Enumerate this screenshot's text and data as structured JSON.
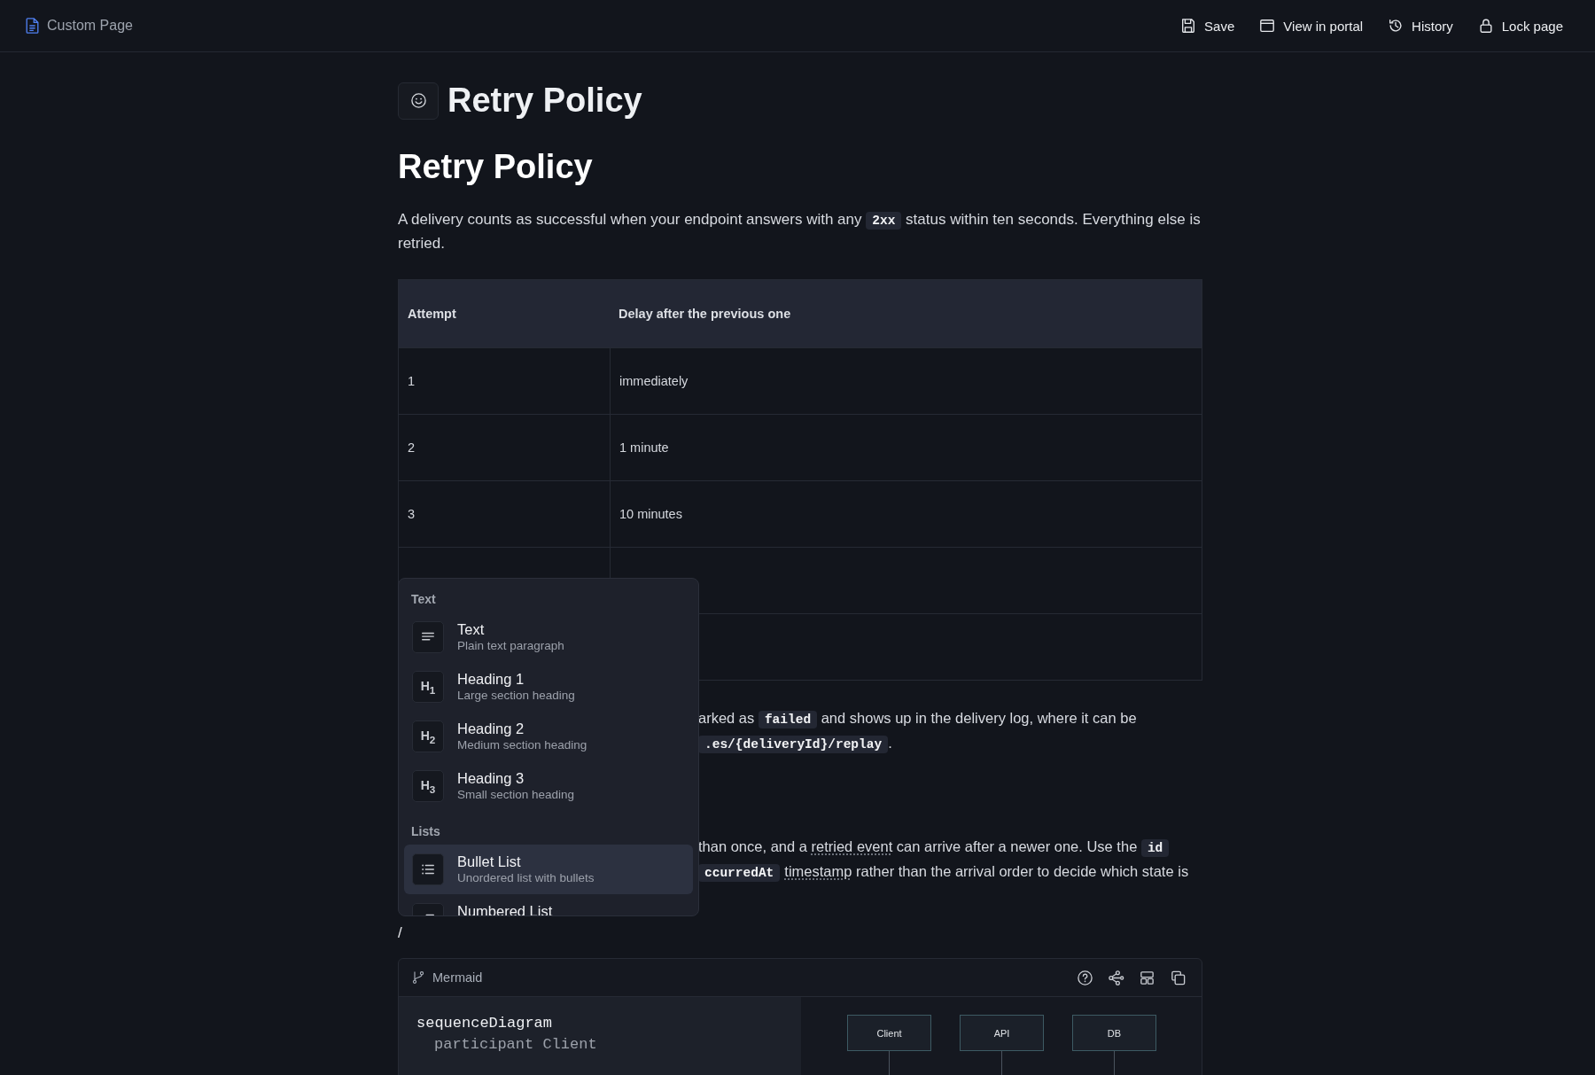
{
  "topbar": {
    "page_name": "Custom Page",
    "actions": [
      {
        "kind": "save",
        "label": "Save"
      },
      {
        "kind": "portal",
        "label": "View in portal"
      },
      {
        "kind": "history",
        "label": "History"
      },
      {
        "kind": "lock",
        "label": "Lock page"
      }
    ]
  },
  "page_title": "Retry Policy",
  "heading": "Retry Policy",
  "intro": [
    {
      "kind": "text",
      "text": "A delivery counts as successful when your endpoint answers with any "
    },
    {
      "kind": "code",
      "text": "2xx"
    },
    {
      "kind": "text",
      "text": " status within ten seconds. Everything else is retried."
    }
  ],
  "table": {
    "columns": [
      "Attempt",
      "Delay after the previous one"
    ],
    "rows": [
      {
        "kind": "row",
        "cells": [
          "1",
          "immediately"
        ]
      },
      {
        "kind": "row",
        "cells": [
          "2",
          "1 minute"
        ]
      },
      {
        "kind": "row",
        "cells": [
          "3",
          "10 minutes"
        ]
      },
      {
        "kind": "covered"
      },
      {
        "kind": "covered"
      }
    ]
  },
  "paragraph_fragments": [
    {
      "lines": [
        [
          {
            "kind": "text",
            "text": "arked as "
          },
          {
            "kind": "code",
            "text": "failed"
          },
          {
            "kind": "text",
            "text": " and shows up in the delivery log, where it can be"
          }
        ],
        [
          {
            "kind": "code",
            "text": ".es/{deliveryId}/replay"
          },
          {
            "kind": "text",
            "text": "."
          }
        ]
      ]
    },
    {
      "lines": [
        [
          {
            "kind": "text",
            "text": "than once, and a "
          },
          {
            "kind": "term",
            "text": "retried event"
          },
          {
            "kind": "text",
            "text": " can arrive after a newer one. Use the "
          },
          {
            "kind": "code",
            "text": "id"
          }
        ],
        [
          {
            "kind": "code",
            "text": "ccurredAt"
          },
          {
            "kind": "term",
            "text": "timestamp"
          },
          {
            "kind": "text",
            "text": " rather than the arrival order to decide which state is"
          }
        ]
      ]
    }
  ],
  "slash_text": "/",
  "mermaid": {
    "label": "Mermaid",
    "code_lines": [
      {
        "kind": "keyword",
        "text": "sequenceDiagram"
      },
      {
        "kind": "statement",
        "text": "participant Client"
      }
    ],
    "participants": [
      "Client",
      "API",
      "DB"
    ]
  },
  "slash_menu": {
    "sections": [
      {
        "label": "Text",
        "items": [
          {
            "kind": "text",
            "title": "Text",
            "subtitle": "Plain text paragraph",
            "selected": false
          },
          {
            "kind": "heading",
            "badge": "H$_{1}$",
            "title": "Heading 1",
            "subtitle": "Large section heading",
            "selected": false
          },
          {
            "kind": "heading",
            "badge": "H$_{2}$",
            "title": "Heading 2",
            "subtitle": "Medium section heading",
            "selected": false
          },
          {
            "kind": "heading",
            "badge": "H$_{3}$",
            "title": "Heading 3",
            "subtitle": "Small section heading",
            "selected": false
          }
        ]
      },
      {
        "label": "Lists",
        "items": [
          {
            "kind": "bullets",
            "title": "Bullet List",
            "subtitle": "Unordered list with bullets",
            "selected": true
          },
          {
            "kind": "numbers",
            "title": "Numbered List",
            "selected": false
          }
        ]
      }
    ]
  }
}
